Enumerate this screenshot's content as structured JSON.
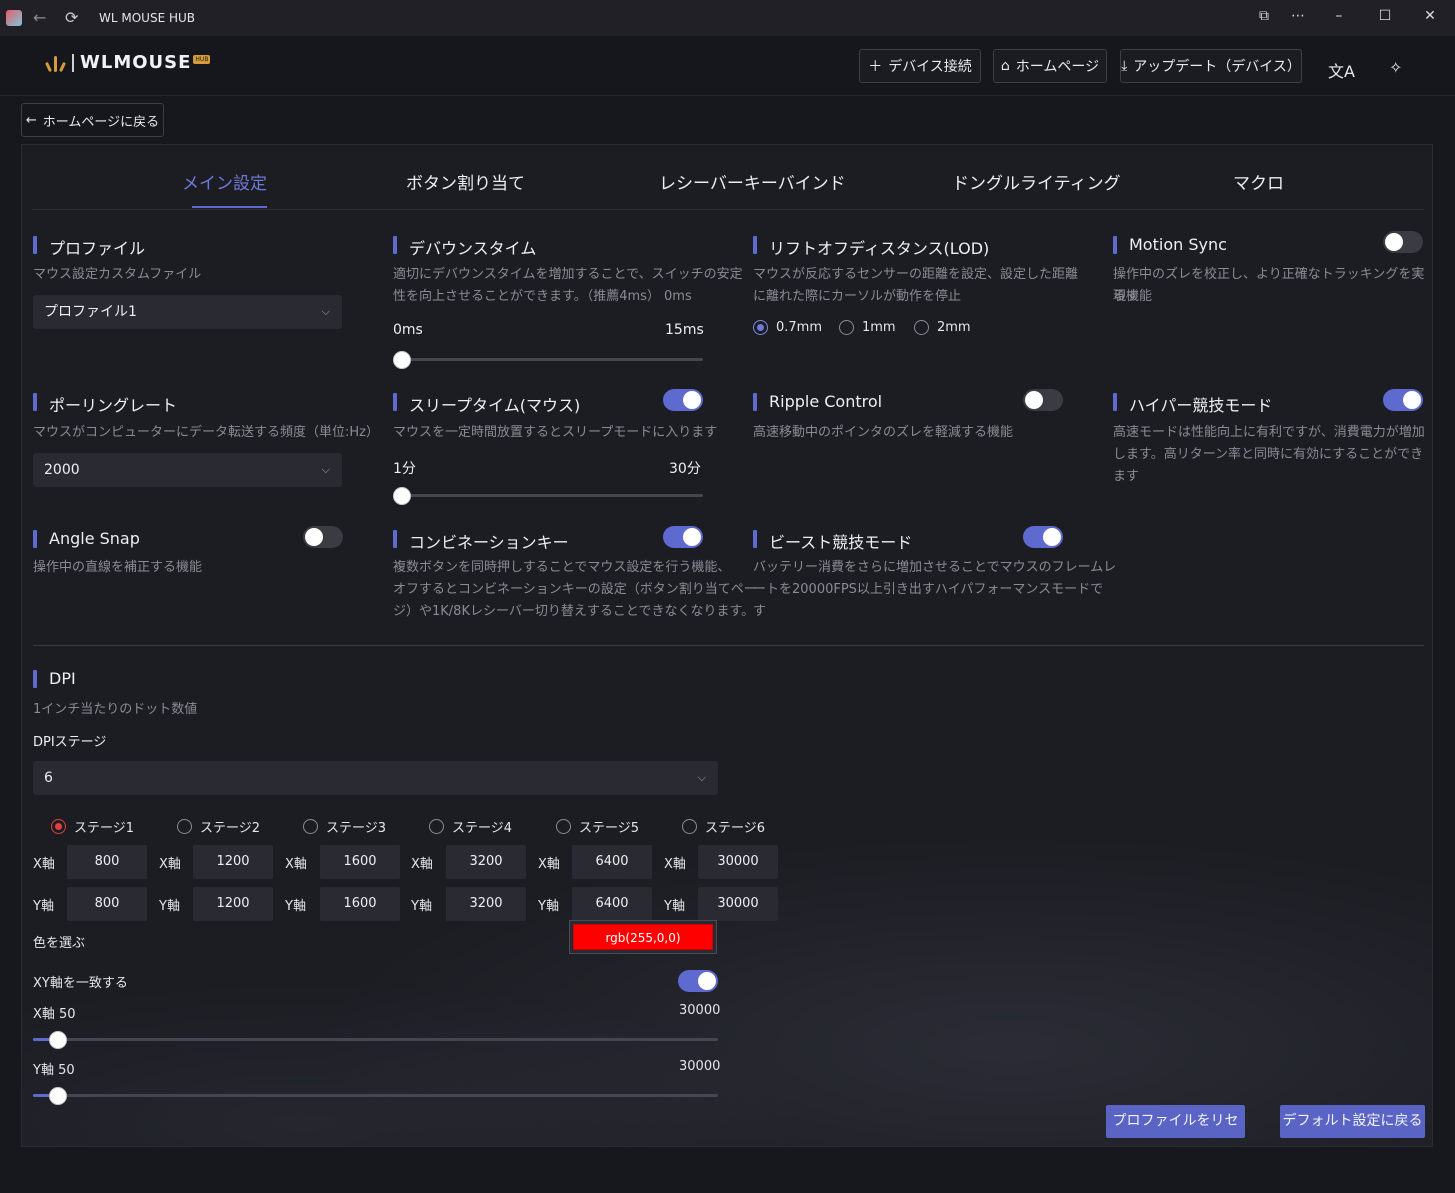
{
  "window": {
    "title": "WL MOUSE HUB"
  },
  "header": {
    "logo_text": "WLMOUSE",
    "logo_badge": "HUB",
    "connect_device": "デバイス接続",
    "homepage": "ホームページ",
    "update_device": "アップデート（デバイス）"
  },
  "back_button": "ホームページに戻る",
  "tabs": [
    "メイン設定",
    "ボタン割り当て",
    "レシーバーキーバインド",
    "ドングルライティング",
    "マクロ"
  ],
  "profile": {
    "title": "プロファイル",
    "desc": "マウス設定カスタムファイル",
    "value": "プロファイル1"
  },
  "debounce": {
    "title": "デバウンスタイム",
    "desc1": "適切にデバウンスタイムを増加することで、スイッチの安定",
    "desc2": "性を向上させることができます。（推薦4ms）  0ms",
    "min": "0ms",
    "max": "15ms",
    "value_ms": 0
  },
  "lod": {
    "title": "リフトオフディスタンス(LOD)",
    "desc1": "マウスが反応するセンサーの距離を設定、設定した距離",
    "desc2": "に離れた際にカーソルが動作を停止",
    "options": [
      "0.7mm",
      "1mm",
      "2mm"
    ],
    "selected": "0.7mm"
  },
  "motion_sync": {
    "title": "Motion Sync",
    "desc1": "操作中のズレを校正し、より正確なトラッキングを実現す",
    "desc2": "る機能",
    "enabled": false
  },
  "polling": {
    "title": "ポーリングレート",
    "desc": "マウスがコンピューターにデータ転送する頻度（単位:Hz）",
    "value": "2000"
  },
  "sleep": {
    "title": "スリープタイム(マウス)",
    "desc": "マウスを一定時間放置するとスリープモードに入ります",
    "min": "1分",
    "max": "30分",
    "enabled": true,
    "value_min": 1
  },
  "ripple": {
    "title": "Ripple Control",
    "desc": "高速移動中のポインタのズレを軽減する機能",
    "enabled": false
  },
  "hyper": {
    "title": "ハイパー競技モード",
    "desc1": "高速モードは性能向上に有利ですが、消費電力が増加",
    "desc2": "します。高リターン率と同時に有効にすることができます",
    "enabled": true
  },
  "angle_snap": {
    "title": "Angle Snap",
    "desc": "操作中の直線を補正する機能",
    "enabled": false
  },
  "combo": {
    "title": "コンビネーションキー",
    "desc1": "複数ボタンを同時押しすることでマウス設定を行う機能、",
    "desc2": "オフするとコンビネーションキーの設定（ボタン割り当てペー",
    "desc3": "ジ）や1K/8Kレシーバー切り替えすることできなくなります。",
    "enabled": true
  },
  "beast": {
    "title": "ビースト競技モード",
    "desc1": "バッテリー消費をさらに増加させることでマウスのフレームレ",
    "desc2": "ートを20000FPS以上引き出すハイパフォーマンスモードで",
    "desc3": "す",
    "enabled": true
  },
  "dpi": {
    "title": "DPI",
    "desc": "1インチ当たりのドット数値",
    "stage_label": "DPIステージ",
    "stage_count": "6",
    "x_label": "X軸",
    "y_label": "Y軸",
    "stages": [
      {
        "name": "ステージ1",
        "x": "800",
        "y": "800"
      },
      {
        "name": "ステージ2",
        "x": "1200",
        "y": "1200"
      },
      {
        "name": "ステージ3",
        "x": "1600",
        "y": "1600"
      },
      {
        "name": "ステージ4",
        "x": "3200",
        "y": "3200"
      },
      {
        "name": "ステージ5",
        "x": "6400",
        "y": "6400"
      },
      {
        "name": "ステージ6",
        "x": "30000",
        "y": "30000"
      }
    ],
    "selected_stage": "ステージ1",
    "color_label": "色を選ぶ",
    "color_value": "rgb(255,0,0)",
    "xy_sync_label": "XY軸を一致する",
    "xy_sync": true,
    "x_slider_label": "X軸 50",
    "y_slider_label": "Y軸 50",
    "slider_max": "30000",
    "x_value": 50,
    "y_value": 50
  },
  "buttons": {
    "reset_profile": "プロファイルをリセット",
    "restore_default": "デフォルト設定に戻る"
  },
  "colors": {
    "accent": "#5f6ad1",
    "selected_stage": "#e0403f",
    "stage_color": "#ff0000"
  }
}
